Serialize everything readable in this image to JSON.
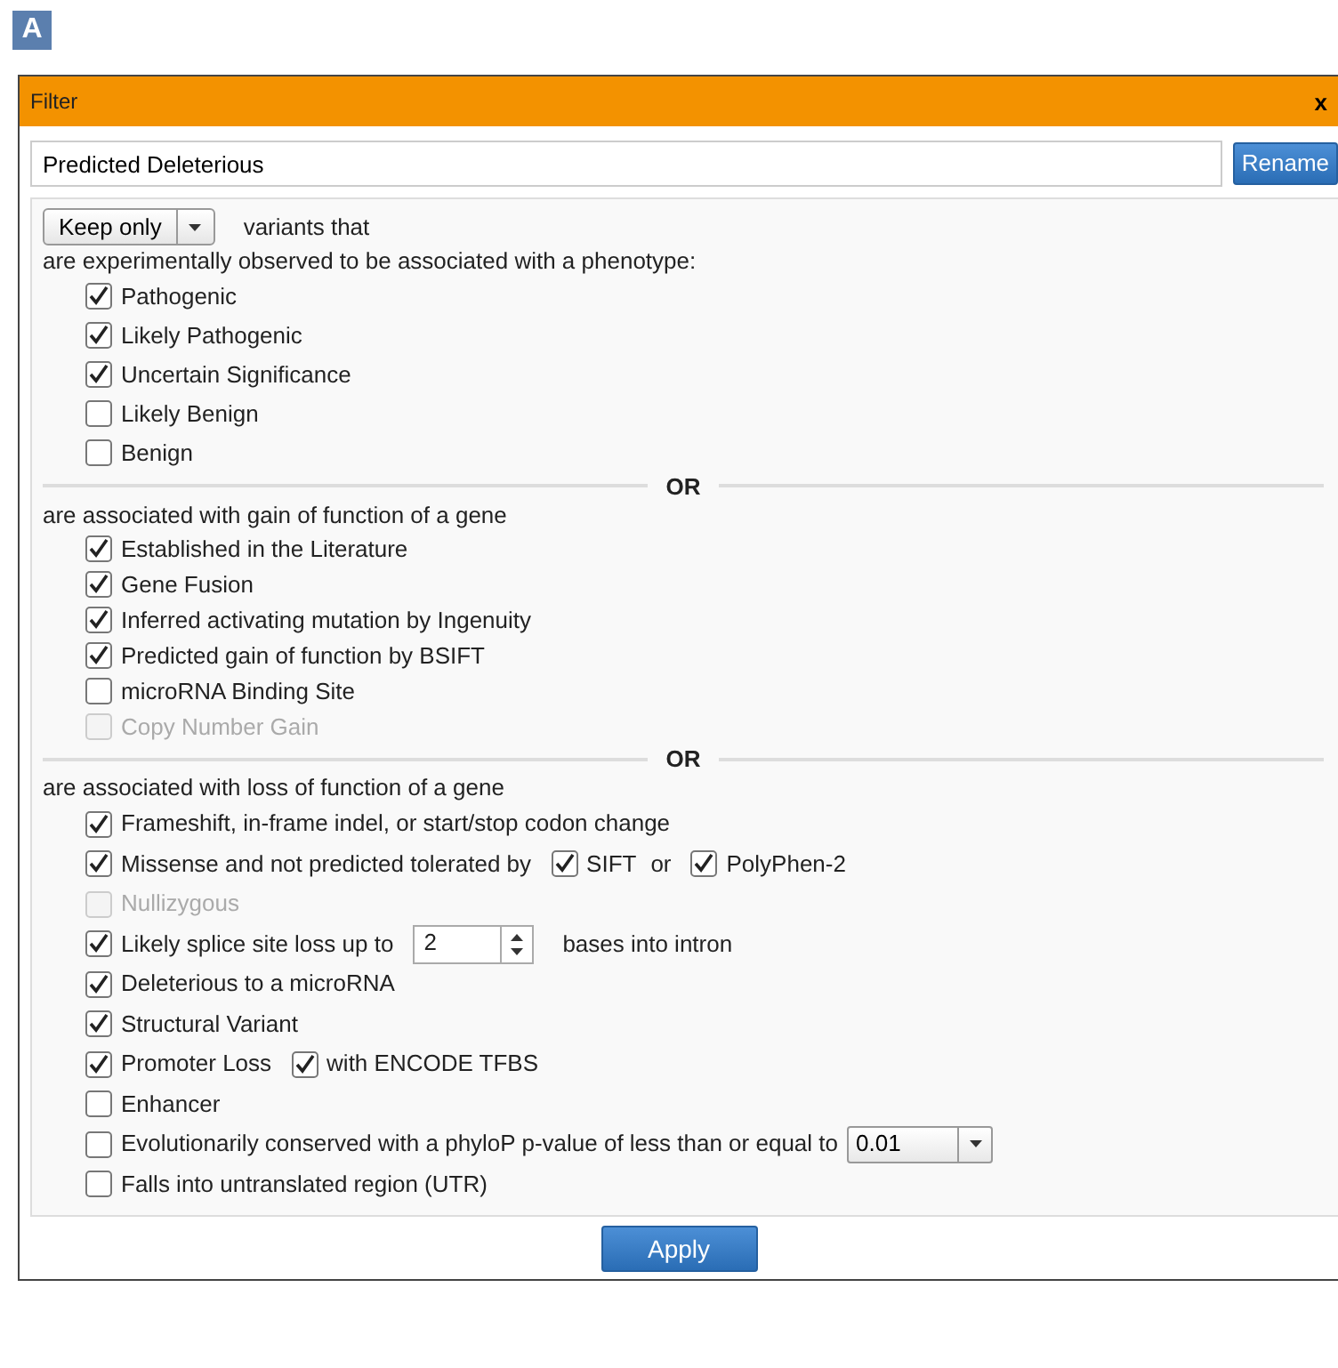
{
  "panel_label": "A",
  "dialog": {
    "title": "Filter",
    "close": "x",
    "name_field": {
      "value": "Predicted Deleterious"
    },
    "rename_button": "Rename",
    "mode": {
      "value": "Keep only",
      "suffix": "variants that"
    },
    "sections": [
      {
        "heading": "are experimentally observed to be associated with a phenotype:",
        "items": [
          {
            "label": "Pathogenic",
            "checked": true,
            "disabled": false
          },
          {
            "label": "Likely Pathogenic",
            "checked": true,
            "disabled": false
          },
          {
            "label": "Uncertain Significance",
            "checked": true,
            "disabled": false
          },
          {
            "label": "Likely Benign",
            "checked": false,
            "disabled": false
          },
          {
            "label": "Benign",
            "checked": false,
            "disabled": false
          }
        ]
      },
      {
        "divider": "OR",
        "heading": "are associated with gain of function of a gene",
        "items": [
          {
            "label": "Established in the Literature",
            "checked": true,
            "disabled": false
          },
          {
            "label": "Gene Fusion",
            "checked": true,
            "disabled": false
          },
          {
            "label": "Inferred activating mutation by Ingenuity",
            "checked": true,
            "disabled": false
          },
          {
            "label": "Predicted gain of function by BSIFT",
            "checked": true,
            "disabled": false
          },
          {
            "label": "microRNA Binding Site",
            "checked": false,
            "disabled": false
          },
          {
            "label": "Copy Number Gain",
            "checked": false,
            "disabled": true
          }
        ]
      },
      {
        "divider": "OR",
        "heading": "are associated with loss of function of a gene",
        "items": [
          {
            "label": "Frameshift, in-frame indel, or start/stop codon change",
            "checked": true,
            "disabled": false
          },
          {
            "label": "Missense and not predicted tolerated by",
            "checked": true,
            "disabled": false,
            "extras": [
              {
                "kind": "check",
                "checked": true,
                "label": "SIFT"
              },
              {
                "kind": "text",
                "text": "or"
              },
              {
                "kind": "check",
                "checked": true,
                "label": "PolyPhen-2"
              }
            ]
          },
          {
            "label": "Nullizygous",
            "checked": false,
            "disabled": true
          },
          {
            "label": "Likely splice site loss up to",
            "checked": true,
            "disabled": false,
            "extras": [
              {
                "kind": "spin",
                "value": "2"
              },
              {
                "kind": "text",
                "text": "bases into intron"
              }
            ]
          },
          {
            "label": "Deleterious to a microRNA",
            "checked": true,
            "disabled": false
          },
          {
            "label": "Structural Variant",
            "checked": true,
            "disabled": false
          },
          {
            "label": "Promoter Loss",
            "checked": true,
            "disabled": false,
            "extras": [
              {
                "kind": "check",
                "checked": true,
                "label": "with ENCODE TFBS"
              }
            ]
          },
          {
            "label": "Enhancer",
            "checked": false,
            "disabled": false
          },
          {
            "label": "Evolutionarily conserved with a phyloP p-value of less than or equal to",
            "checked": false,
            "disabled": false,
            "extras": [
              {
                "kind": "select",
                "value": "0.01"
              }
            ]
          },
          {
            "label": "Falls into untranslated region (UTR)",
            "checked": false,
            "disabled": false
          }
        ]
      }
    ],
    "apply_button": "Apply"
  }
}
